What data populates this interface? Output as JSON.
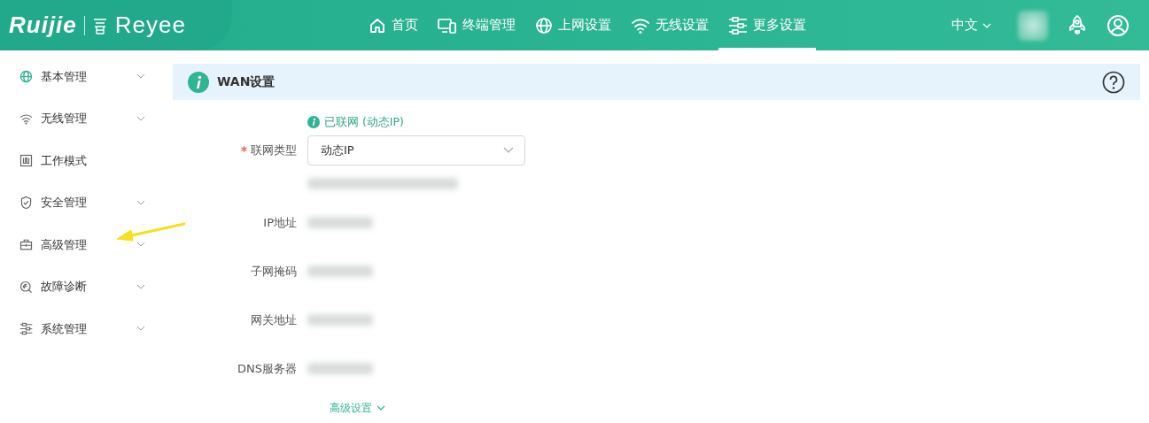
{
  "header": {
    "logo": {
      "brand": "Ruijie",
      "product": "Reyee"
    },
    "nav": [
      {
        "label": "首页",
        "selected": false
      },
      {
        "label": "终端管理",
        "selected": false
      },
      {
        "label": "上网设置",
        "selected": false
      },
      {
        "label": "无线设置",
        "selected": false
      },
      {
        "label": "更多设置",
        "selected": true
      }
    ],
    "language": "中文"
  },
  "sidebar": {
    "items": [
      {
        "label": "基本管理",
        "expandable": true
      },
      {
        "label": "无线管理",
        "expandable": true
      },
      {
        "label": "工作模式",
        "expandable": false
      },
      {
        "label": "安全管理",
        "expandable": true
      },
      {
        "label": "高级管理",
        "expandable": true
      },
      {
        "label": "故障诊断",
        "expandable": true
      },
      {
        "label": "系统管理",
        "expandable": true
      }
    ]
  },
  "panel": {
    "title": "WAN设置",
    "status": "已联网 (动态IP)",
    "fields": [
      {
        "kind": "select",
        "label": "联网类型",
        "required": true,
        "value": "动态IP"
      },
      {
        "kind": "redacted"
      },
      {
        "kind": "redacted",
        "label": "IP地址",
        "required": false
      },
      {
        "kind": "redacted",
        "label": "子网掩码",
        "required": false
      },
      {
        "kind": "redacted",
        "label": "网关地址",
        "required": false
      },
      {
        "kind": "redacted",
        "label": "DNS服务器",
        "required": false
      }
    ],
    "advanced_link": "高级设置"
  }
}
